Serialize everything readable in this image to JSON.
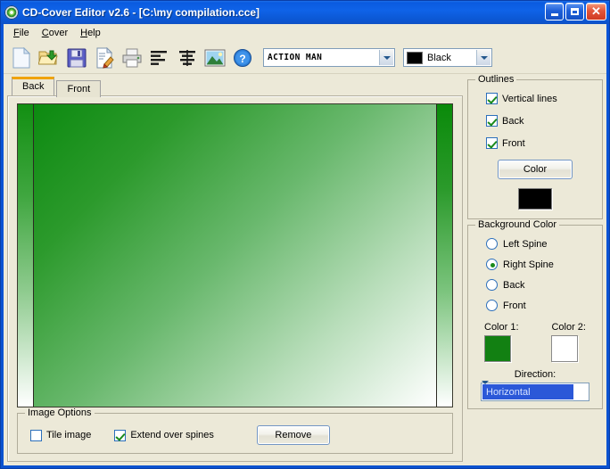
{
  "window": {
    "title": "CD-Cover Editor v2.6 - [C:\\my compilation.cce]",
    "icon": "cd-disc-icon",
    "minimize_label": "",
    "maximize_label": "",
    "close_label": "✕"
  },
  "menubar": {
    "items": [
      {
        "label": "File",
        "accel": "F"
      },
      {
        "label": "Cover",
        "accel": "C"
      },
      {
        "label": "Help",
        "accel": "H"
      }
    ]
  },
  "toolbar": {
    "buttons": [
      {
        "name": "new-file-icon",
        "tooltip": "New"
      },
      {
        "name": "open-folder-icon",
        "tooltip": "Open"
      },
      {
        "name": "save-floppy-icon",
        "tooltip": "Save"
      },
      {
        "name": "edit-document-icon",
        "tooltip": "Edit"
      },
      {
        "name": "print-icon",
        "tooltip": "Print"
      },
      {
        "name": "align-left-icon",
        "tooltip": "Align left"
      },
      {
        "name": "align-center-icon",
        "tooltip": "Center"
      },
      {
        "name": "insert-image-icon",
        "tooltip": "Insert image"
      },
      {
        "name": "help-question-icon",
        "tooltip": "Help"
      }
    ],
    "font_combo": {
      "value": "ACTION MAN"
    },
    "color_combo": {
      "value": "Black",
      "swatch": "#000000"
    }
  },
  "tabs": [
    {
      "label": "Back",
      "active": true
    },
    {
      "label": "Front",
      "active": false
    }
  ],
  "cover_preview": {
    "left_spine": {
      "gradient_from": "#128f12",
      "gradient_to": "#ffffff"
    },
    "main": {
      "gradient_from": "#0f8b10",
      "gradient_to": "#ffffff"
    },
    "right_spine": {
      "gradient_from": "#0a8a0a",
      "gradient_to": "#ffffff"
    },
    "outline_color": "#2b2b22"
  },
  "image_options": {
    "title": "Image Options",
    "tile_image": {
      "label": "Tile image",
      "checked": false
    },
    "extend_over_spines": {
      "label": "Extend over spines",
      "checked": true
    },
    "remove_button": "Remove"
  },
  "outlines": {
    "title": "Outlines",
    "checkboxes": [
      {
        "label": "Vertical lines",
        "checked": true
      },
      {
        "label": "Back",
        "checked": true
      },
      {
        "label": "Front",
        "checked": true
      }
    ],
    "color_button": "Color",
    "swatch": "#000000"
  },
  "background_color": {
    "title": "Background Color",
    "radios": [
      {
        "label": "Left Spine",
        "selected": false
      },
      {
        "label": "Right Spine",
        "selected": true
      },
      {
        "label": "Back",
        "selected": false
      },
      {
        "label": "Front",
        "selected": false
      }
    ],
    "color1_label": "Color 1:",
    "color1_value": "#128012",
    "color2_label": "Color 2:",
    "color2_value": "#ffffff",
    "direction_label": "Direction:",
    "direction_value": "Horizontal"
  }
}
